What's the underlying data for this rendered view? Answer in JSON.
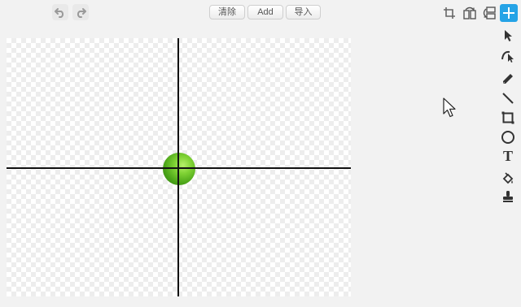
{
  "toolbar": {
    "clear_label": "清除",
    "add_label": "Add",
    "import_label": "导入"
  },
  "icons": {
    "undo": "undo-icon",
    "redo": "redo-icon",
    "crop": "crop-icon",
    "flip_horizontal": "flip-horizontal-icon",
    "flip_vertical": "flip-vertical-icon",
    "set_center": "set-center-icon"
  },
  "tools": [
    {
      "name": "select-tool",
      "icon": "arrow-pointer-icon"
    },
    {
      "name": "reshape-tool",
      "icon": "reshape-icon"
    },
    {
      "name": "pencil-tool",
      "icon": "pencil-icon"
    },
    {
      "name": "line-tool",
      "icon": "line-icon"
    },
    {
      "name": "rectangle-tool",
      "icon": "rectangle-icon"
    },
    {
      "name": "ellipse-tool",
      "icon": "ellipse-icon"
    },
    {
      "name": "text-tool",
      "icon": "text-icon",
      "glyph": "T"
    },
    {
      "name": "fill-tool",
      "icon": "paint-bucket-icon"
    },
    {
      "name": "stamp-tool",
      "icon": "stamp-icon"
    }
  ],
  "colors": {
    "accent": "#25a3e6",
    "sprite_green": "#4aa318",
    "axis": "#111111"
  }
}
